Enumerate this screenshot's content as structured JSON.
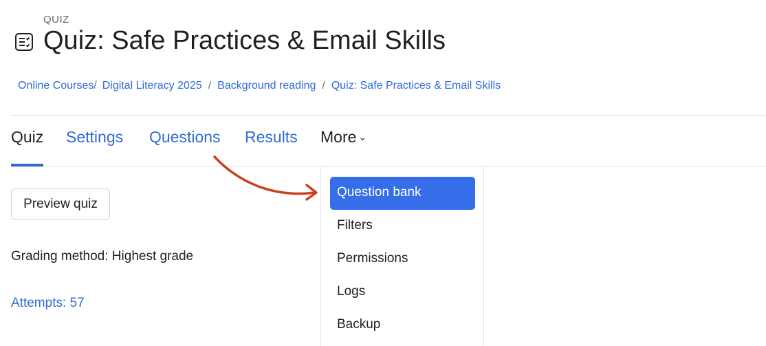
{
  "header": {
    "activity_label": "QUIZ",
    "title": "Quiz: Safe Practices & Email Skills"
  },
  "breadcrumb": {
    "items": [
      "Online Courses",
      "Digital Literacy 2025",
      "Background reading",
      "Quiz: Safe Practices & Email Skills"
    ],
    "separator": "/"
  },
  "tabs": {
    "items": [
      "Quiz",
      "Settings",
      "Questions",
      "Results"
    ],
    "more_label": "More",
    "more_chevron": "⌄",
    "active": "Quiz"
  },
  "main": {
    "preview_button": "Preview quiz",
    "grading_method": "Grading method: Highest grade",
    "attempts": "Attempts: 57"
  },
  "more_menu": {
    "items": [
      "Question bank",
      "Filters",
      "Permissions",
      "Logs",
      "Backup"
    ],
    "highlighted": "Question bank"
  },
  "colors": {
    "accent": "#2f6bd7",
    "menu_highlight": "#356ee8",
    "annotation_arrow": "#c8421f",
    "text": "#1d2125"
  },
  "icons": {
    "quiz": "quiz-checklist-icon",
    "annotation": "curved-arrow-icon"
  }
}
